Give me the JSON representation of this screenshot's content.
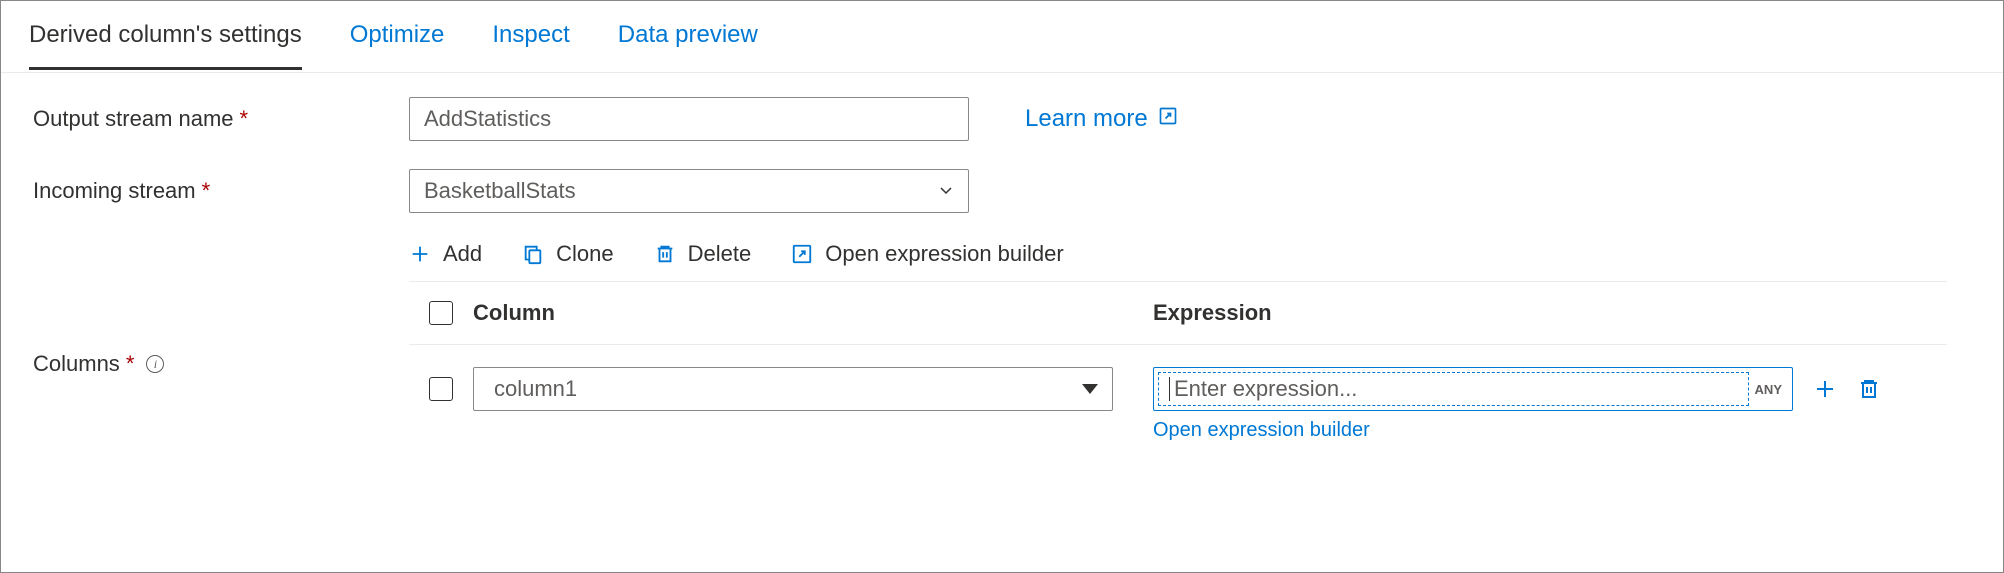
{
  "tabs": {
    "settings": "Derived column's settings",
    "optimize": "Optimize",
    "inspect": "Inspect",
    "data_preview": "Data preview"
  },
  "fields": {
    "output_stream_label": "Output stream name",
    "output_stream_value": "AddStatistics",
    "incoming_stream_label": "Incoming stream",
    "incoming_stream_value": "BasketballStats",
    "columns_label": "Columns"
  },
  "links": {
    "learn_more": "Learn more",
    "open_expression_builder": "Open expression builder"
  },
  "toolbar": {
    "add": "Add",
    "clone": "Clone",
    "delete": "Delete",
    "open_builder": "Open expression builder"
  },
  "columns_table": {
    "header_column": "Column",
    "header_expression": "Expression",
    "rows": [
      {
        "column_name": "column1",
        "expression_placeholder": "Enter expression...",
        "type_badge": "ANY"
      }
    ]
  }
}
